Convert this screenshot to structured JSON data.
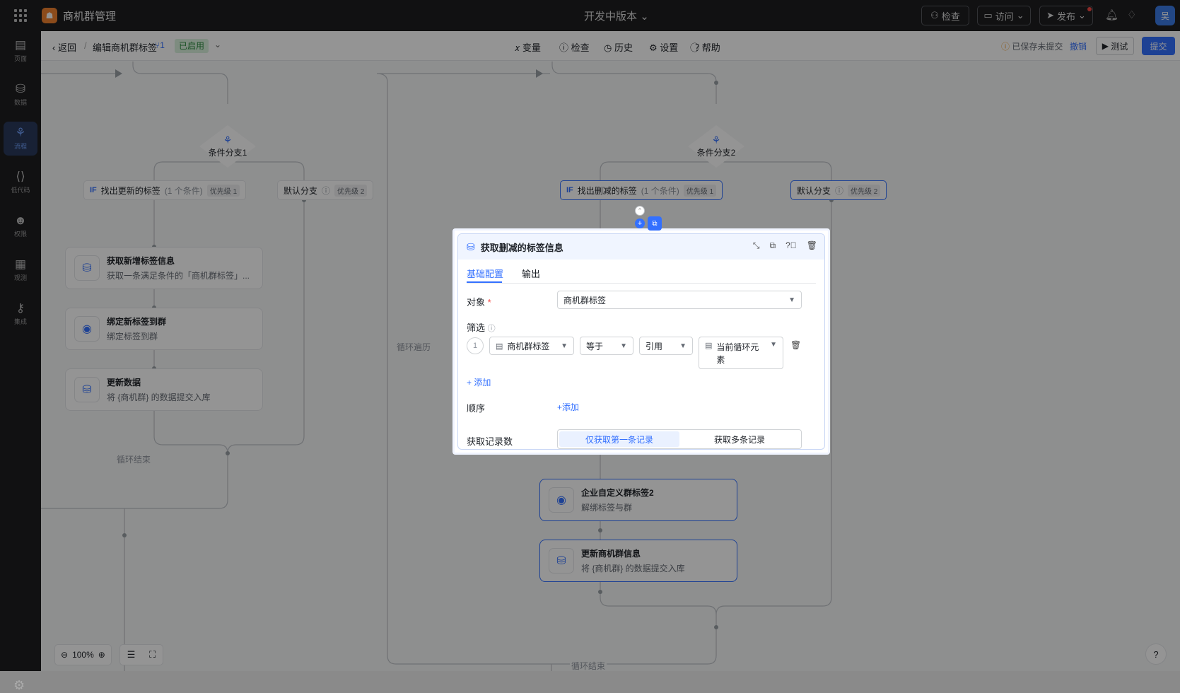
{
  "header": {
    "app_title": "商机群管理",
    "version_label": "开发中版本",
    "check_label": "检查",
    "visit_label": "访问",
    "publish_label": "发布",
    "user_initial": "吴"
  },
  "sidebar": {
    "items": [
      {
        "label": "页面",
        "icon": "page-icon"
      },
      {
        "label": "数据",
        "icon": "database-icon"
      },
      {
        "label": "流程",
        "icon": "flow-icon",
        "active": true
      },
      {
        "label": "低代码",
        "icon": "code-icon"
      },
      {
        "label": "权限",
        "icon": "permission-icon"
      },
      {
        "label": "观测",
        "icon": "observe-icon"
      },
      {
        "label": "集成",
        "icon": "integration-icon"
      }
    ]
  },
  "subbar": {
    "back_label": "返回",
    "flow_title": "编辑商机群标签",
    "version_num": "1",
    "status_badge": "已启用",
    "menu": [
      "变量",
      "检查",
      "历史",
      "设置",
      "帮助"
    ],
    "saved_text": "已保存未提交",
    "undo_label": "撤销",
    "test_label": "测试",
    "submit_label": "提交"
  },
  "canvas": {
    "branch1": {
      "label": "条件分支1"
    },
    "branch2": {
      "label": "条件分支2"
    },
    "cond_left": {
      "if": "IF",
      "name": "找出更新的标签",
      "count": "(1 个条件)",
      "prio": "优先级 1"
    },
    "default_left": {
      "name": "默认分支",
      "prio": "优先级 2"
    },
    "cond_right": {
      "if": "IF",
      "name": "找出删减的标签",
      "count": "(1 个条件)",
      "prio": "优先级 1"
    },
    "default_right": {
      "name": "默认分支",
      "prio": "优先级 2"
    },
    "left_nodes": [
      {
        "title": "获取新增标签信息",
        "sub": "获取一条满足条件的「商机群标签」..."
      },
      {
        "title": "绑定新标签到群",
        "sub": "绑定标签到群"
      },
      {
        "title": "更新数据",
        "sub": "将 {商机群} 的数据提交入库"
      }
    ],
    "right_nodes": [
      {
        "title": "企业自定义群标签2",
        "sub": "解绑标签与群"
      },
      {
        "title": "更新商机群信息",
        "sub": "将 {商机群} 的数据提交入库"
      }
    ],
    "loop_traverse": "循环遍历",
    "loop_end_left": "循环结束",
    "loop_end_bottom": "循环结束",
    "zoom": "100%"
  },
  "panel": {
    "title": "获取删减的标签信息",
    "tabs": [
      "基础配置",
      "输出"
    ],
    "object_label": "对象",
    "object_value": "商机群标签",
    "filter_label": "筛选",
    "filter_index": "1",
    "filter_field": "商机群标签",
    "filter_op": "等于",
    "filter_mode": "引用",
    "filter_value": "当前循环元素",
    "add_filter": "添加",
    "order_label": "顺序",
    "add_order": "添加",
    "count_label": "获取记录数",
    "count_options": [
      "仅获取第一条记录",
      "获取多条记录"
    ]
  },
  "colors": {
    "accent": "#3370ff",
    "topbar": "#1e1e20",
    "badge_bg": "#d9f2dc"
  }
}
